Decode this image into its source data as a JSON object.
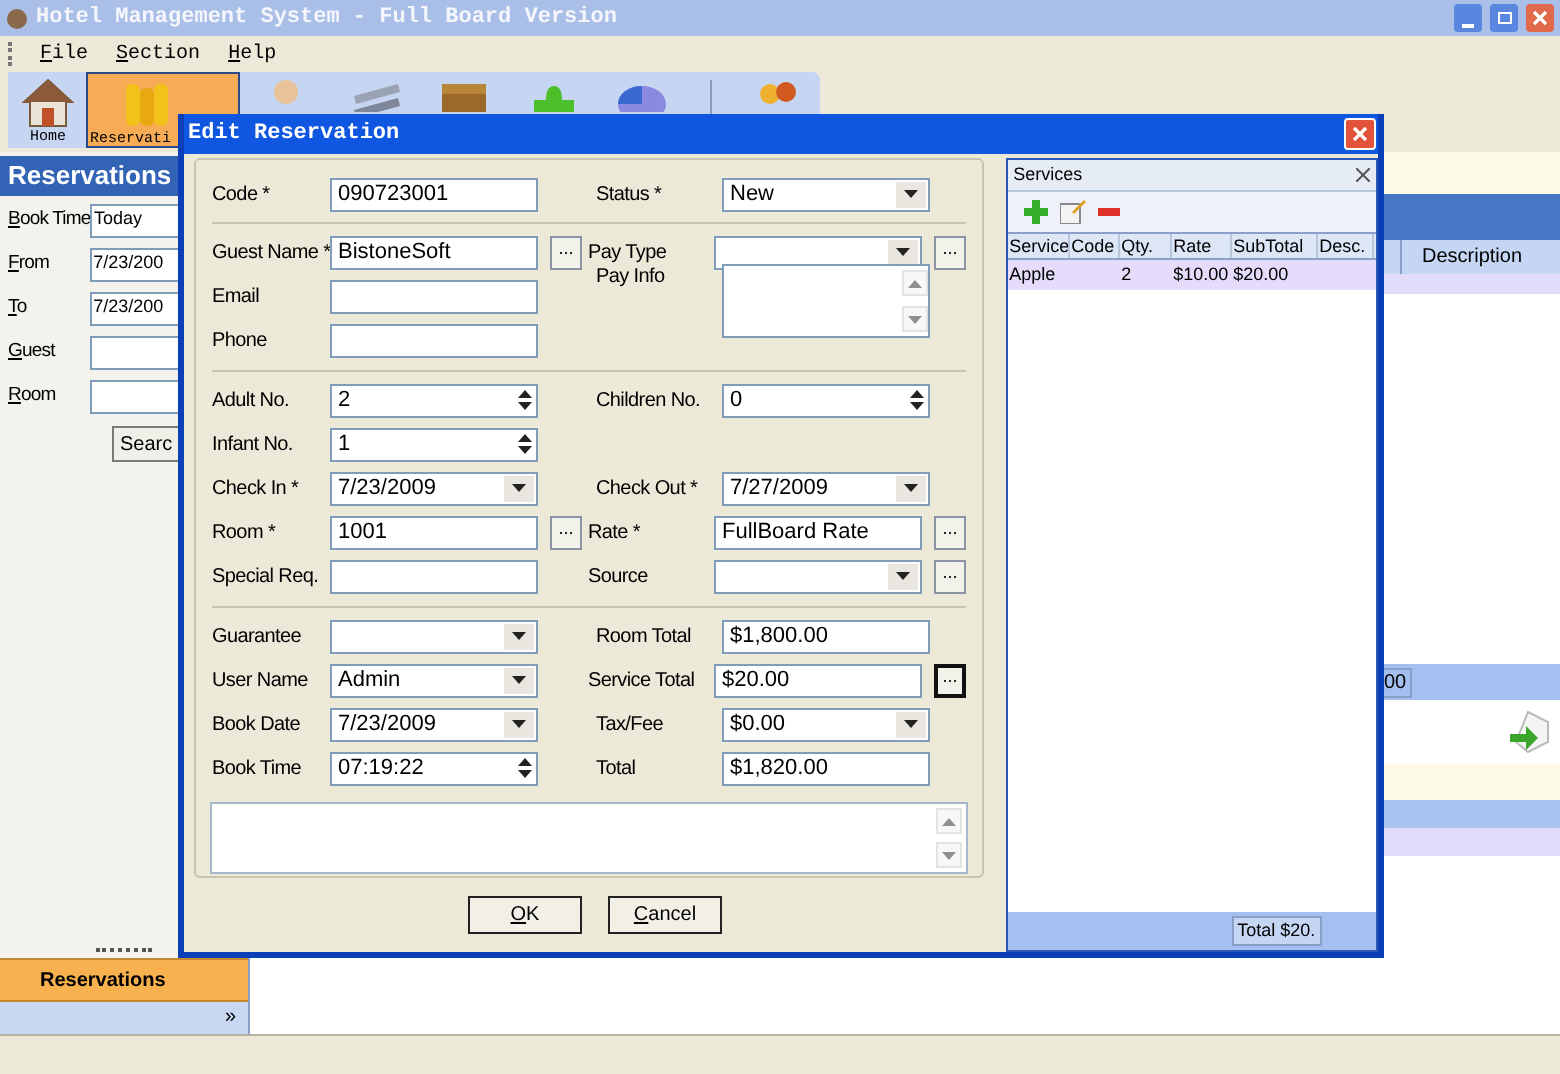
{
  "window": {
    "title": "Hotel Management System - Full Board Version"
  },
  "menu": [
    {
      "label": "File"
    },
    {
      "label": "Section"
    },
    {
      "label": "Help"
    }
  ],
  "toolbar": [
    {
      "kind": "home",
      "label": "Home",
      "selected": false
    },
    {
      "kind": "coins",
      "label": "Reservati",
      "selected": true
    },
    {
      "kind": "person",
      "selected": false
    },
    {
      "kind": "skis",
      "selected": false
    },
    {
      "kind": "box",
      "selected": false
    },
    {
      "kind": "puzzle",
      "selected": false
    },
    {
      "kind": "pie",
      "selected": false
    },
    {
      "kind": "people",
      "selected": false
    }
  ],
  "filter_panel": {
    "title": "Reservations",
    "fields": [
      {
        "label": "Book Time",
        "value": "Today"
      },
      {
        "label": "From",
        "value": "7/23/200"
      },
      {
        "label": "To",
        "value": "7/23/200"
      },
      {
        "label": "Guest"
      },
      {
        "label": "Room"
      }
    ],
    "search_button": "Searc"
  },
  "nav_button": {
    "label": "Reservations",
    "chevron": "»"
  },
  "background_grid": {
    "column": "Description",
    "cell": "00"
  },
  "dialog": {
    "title": "Edit Reservation",
    "sections": [
      [
        {
          "left": {
            "label": "Code *",
            "value": "090723001",
            "kind": "text"
          },
          "right": {
            "label": "Status *",
            "value": "New",
            "kind": "dropdown"
          }
        }
      ],
      [
        {
          "left": {
            "label": "Guest Name *",
            "value": "BistoneSoft",
            "kind": "text",
            "button": {
              "label": "...",
              "focused": false
            }
          },
          "right": {
            "label": "Pay Type",
            "kind": "dropdown",
            "button": {
              "label": "...",
              "focused": false
            }
          }
        },
        {
          "left": {
            "label": "Email",
            "kind": "text"
          },
          "right": {
            "label": "Pay Info",
            "kind": "memo"
          }
        },
        {
          "left": {
            "label": "Phone",
            "kind": "text"
          }
        }
      ],
      [
        {
          "left": {
            "label": "Adult No.",
            "value": "2",
            "kind": "spin"
          },
          "right": {
            "label": "Children No.",
            "value": "0",
            "kind": "spin"
          }
        },
        {
          "left": {
            "label": "Infant No.",
            "value": "1",
            "kind": "spin"
          }
        },
        {
          "left": {
            "label": "Check In *",
            "value": "7/23/2009",
            "kind": "dropdown"
          },
          "right": {
            "label": "Check Out *",
            "value": "7/27/2009",
            "kind": "dropdown"
          }
        },
        {
          "left": {
            "label": "Room *",
            "value": "1001",
            "kind": "text",
            "button": {
              "label": "...",
              "focused": false
            }
          },
          "right": {
            "label": "Rate *",
            "value": "FullBoard Rate",
            "kind": "text",
            "button": {
              "label": "...",
              "focused": false
            }
          }
        },
        {
          "left": {
            "label": "Special Req.",
            "kind": "text"
          },
          "right": {
            "label": "Source",
            "kind": "dropdown",
            "button": {
              "label": "...",
              "focused": false
            }
          }
        }
      ],
      [
        {
          "left": {
            "label": "Guarantee",
            "kind": "dropdown"
          },
          "right": {
            "label": "Room Total",
            "value": "$1,800.00",
            "kind": "text"
          }
        },
        {
          "left": {
            "label": "User Name",
            "value": "Admin",
            "kind": "dropdown"
          },
          "right": {
            "label": "Service Total",
            "value": "$20.00",
            "kind": "text",
            "button": {
              "label": "...",
              "focused": true
            }
          }
        },
        {
          "left": {
            "label": "Book Date",
            "value": "7/23/2009",
            "kind": "dropdown"
          },
          "right": {
            "label": "Tax/Fee",
            "value": "$0.00",
            "kind": "dropdown"
          }
        },
        {
          "left": {
            "label": "Book Time",
            "value": "07:19:22",
            "kind": "spin"
          },
          "right": {
            "label": "Total",
            "value": "$1,820.00",
            "kind": "text"
          }
        }
      ]
    ],
    "buttons": [
      {
        "label": "OK"
      },
      {
        "label": "Cancel"
      }
    ]
  },
  "services": {
    "title": "Services",
    "columns": [
      "Service",
      "Code",
      "Qty.",
      "Rate",
      "SubTotal",
      "Desc."
    ],
    "rows": [
      {
        "service": "Apple",
        "qty": "2",
        "rate": "$10.00",
        "subtotal": "$20.00",
        "selected": true
      }
    ],
    "total": "Total $20."
  }
}
